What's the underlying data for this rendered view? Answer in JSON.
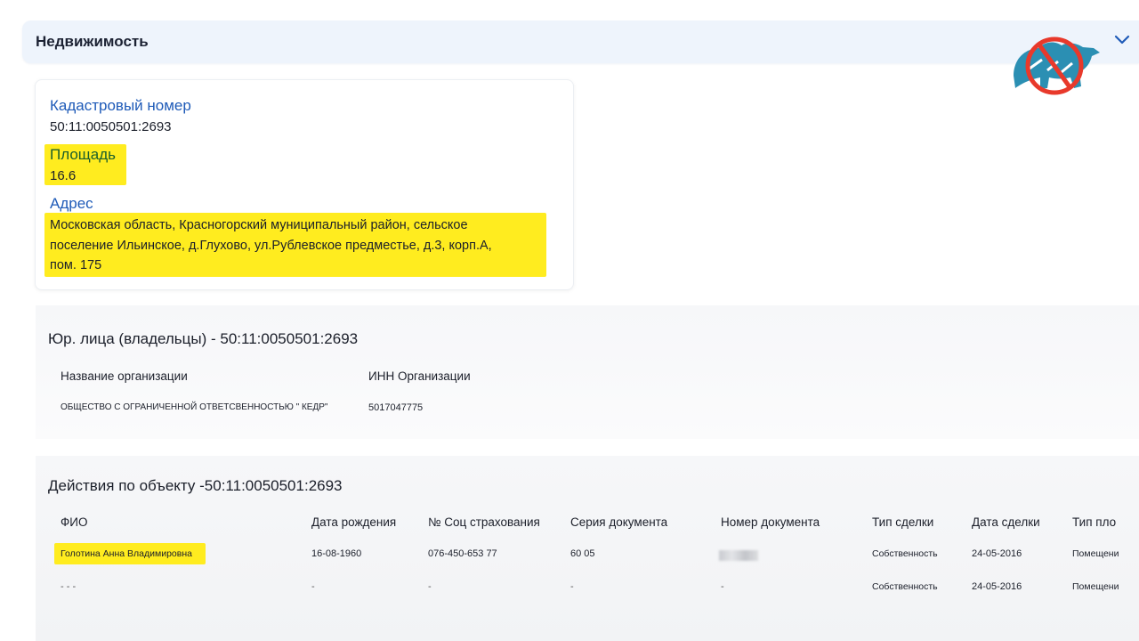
{
  "accordion": {
    "title": "Недвижимость"
  },
  "property": {
    "cadastral_label": "Кадастровый номер",
    "cadastral_value": "50:11:0050501:2693",
    "area_label": "Площадь",
    "area_value": "16.6",
    "address_label": "Адрес",
    "address_lines": [
      "Московская область, Красногорский муниципальный район, сельское",
      "поселение Ильинское, д.Глухово, ул.Рублевское предместье, д.3, корп.А,",
      "пом. 175"
    ]
  },
  "owners": {
    "title": "Юр. лица (владельцы) - 50:11:0050501:2693",
    "headers": [
      "Название организации",
      "ИНН Организации"
    ],
    "rows": [
      [
        "ОБЩЕСТВО С ОГРАНИЧЕННОЙ ОТВЕТСВЕННОСТЬЮ \" КЕДР\"",
        "5017047775"
      ]
    ]
  },
  "actions": {
    "title": "Действия по объекту -50:11:0050501:2693",
    "headers": [
      "ФИО",
      "Дата рождения",
      "№ Соц страхования",
      "Серия документа",
      "Номер документа",
      "Тип сделки",
      "Дата сделки",
      "Тип пло"
    ],
    "rows": [
      [
        "Голотина Анна Владимировна",
        "16-08-1960",
        "076-450-653 77",
        "60 05",
        "",
        "Собственность",
        "24-05-2016",
        "Помещени"
      ],
      [
        "- - -",
        "-",
        "-",
        "-",
        "-",
        "Собственность",
        "24-05-2016",
        "Помещени"
      ]
    ]
  },
  "colors": {
    "highlight": "#ffec1f",
    "label_blue": "#1f5bb8",
    "header_bg": "#eef4fc"
  }
}
